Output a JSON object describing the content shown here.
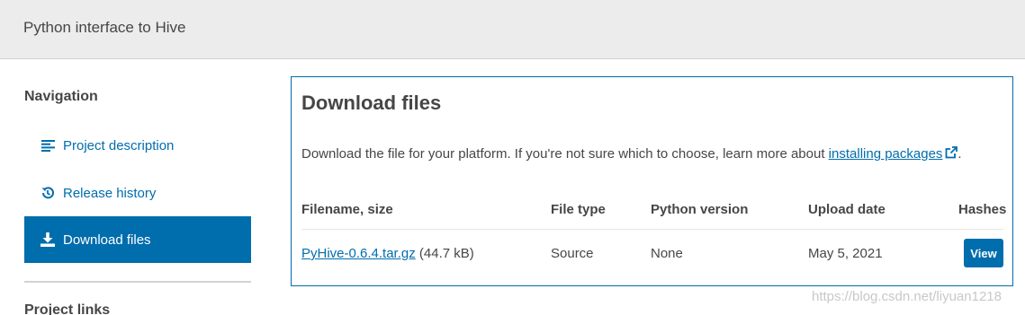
{
  "header": {
    "summary": "Python interface to Hive"
  },
  "sidebar": {
    "heading": "Navigation",
    "items": [
      {
        "label": "Project description",
        "icon": "align-left-icon",
        "active": false
      },
      {
        "label": "Release history",
        "icon": "history-icon",
        "active": false
      },
      {
        "label": "Download files",
        "icon": "download-icon",
        "active": true
      }
    ],
    "links_heading": "Project links"
  },
  "files": {
    "title": "Download files",
    "intro_text": "Download the file for your platform. If you're not sure which to choose, learn more about",
    "intro_link": "installing packages",
    "intro_end": ".",
    "columns": [
      "Filename, size",
      "File type",
      "Python version",
      "Upload date",
      "Hashes"
    ],
    "rows": [
      {
        "filename": "PyHive-0.6.4.tar.gz",
        "size": "(44.7 kB)",
        "file_type": "Source",
        "python_version": "None",
        "upload_date": "May 5, 2021",
        "hashes_button": "View"
      }
    ]
  },
  "watermark": "https://blog.csdn.net/liyuan1218",
  "colors": {
    "accent": "#006dad",
    "header_bg": "#ececec",
    "text": "#464646"
  }
}
